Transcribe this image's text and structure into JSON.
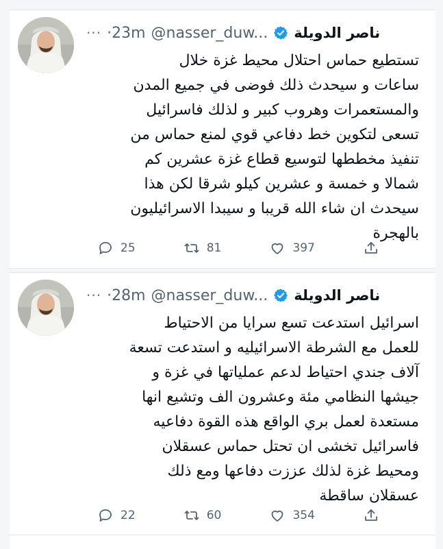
{
  "tweets": [
    {
      "author": "ناصر الدويلة",
      "handle": "@nasser_duw...",
      "time": "·23m",
      "more": "···",
      "lines": [
        "تستطيع حماس احتلال محيط غزة خلال",
        "ساعات و سيحدث ذلك فوضى في جميع المدن",
        "والمستعمرات وهروب كبير و لذلك فاسرائيل",
        "تسعى لتكوين خط دفاعي قوي لمنع حماس من",
        "تنفيذ مخططها لتوسيع قطاع غزة عشرين كم",
        "شمالا و خمسة و عشرين كيلو شرقا لكن هذا",
        "سيحدث ان شاء الله قريبا و سيبدا الاسرائيليون",
        "بالهجرة"
      ],
      "replies": "25",
      "retweets": "81",
      "likes": "397"
    },
    {
      "author": "ناصر الدويلة",
      "handle": "@nasser_duw...",
      "time": "·28m",
      "more": "···",
      "lines": [
        "اسرائيل استدعت تسع سرايا من الاحتياط",
        "للعمل مع الشرطة الاسرائيليه و استدعت تسعة",
        "آلاف جندي احتياط لدعم عملياتها في غزة و",
        "جيشها النظامي مئة وعشرون الف وتشيع انها",
        "مستعدة لعمل بري الواقع هذه القوة دفاعيه",
        "فاسرائيل تخشى ان تحتل حماس عسقلان",
        "ومحيط غزة لذلك عززت دفاعها ومع ذلك",
        "عسقلان ساقطة"
      ],
      "replies": "22",
      "retweets": "60",
      "likes": "354"
    }
  ],
  "icons": {
    "verified": "verified-badge-icon",
    "reply": "reply-icon",
    "retweet": "retweet-icon",
    "like": "like-icon",
    "share": "share-icon"
  },
  "colors": {
    "verified": "#1d9bf0",
    "muted": "#536471"
  }
}
